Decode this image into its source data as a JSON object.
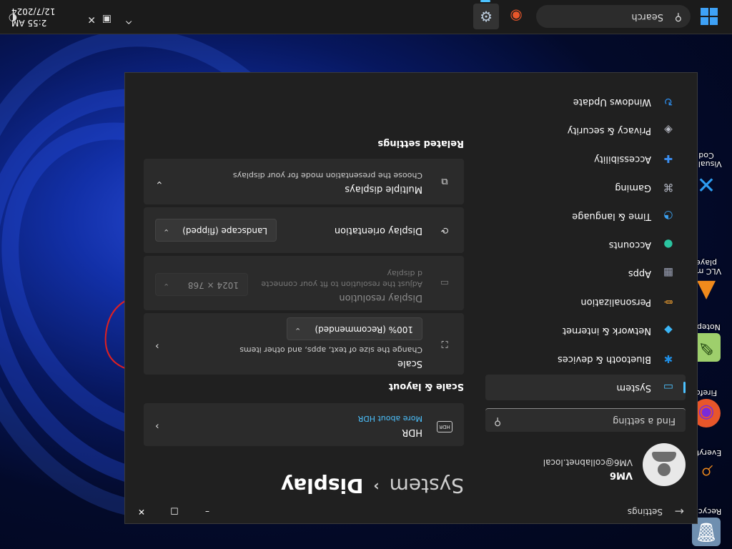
{
  "desktop": {
    "icons": [
      {
        "label": "Recycle",
        "glyph": "🗑"
      },
      {
        "label": "Everyth",
        "glyph": "⌕"
      },
      {
        "label": "Firefo",
        "glyph": "◉"
      },
      {
        "label": "Notepa",
        "glyph": "✎"
      },
      {
        "label": "VLC me\nplaye",
        "glyph": "▲"
      },
      {
        "label": "Visual S\nCod",
        "glyph": "✕"
      }
    ]
  },
  "window": {
    "app_title": "Settings",
    "back_icon": "back-arrow-icon",
    "controls": {
      "minimize": "–",
      "maximize": "□",
      "close": "✕"
    }
  },
  "nav": {
    "user_name": "VM6",
    "user_email": "VM6@collabnet.local",
    "search_placeholder": "Find a setting",
    "items": [
      {
        "label": "System",
        "icon": "system-icon",
        "glyph": "▭",
        "color": "#4cc2ff"
      },
      {
        "label": "Bluetooth & devices",
        "icon": "bluetooth-icon",
        "glyph": "✱",
        "color": "#1f8fe6"
      },
      {
        "label": "Network & internet",
        "icon": "network-icon",
        "glyph": "◆",
        "color": "#3bb5f5"
      },
      {
        "label": "Personalization",
        "icon": "personalization-icon",
        "glyph": "✏",
        "color": "#f0a030"
      },
      {
        "label": "Apps",
        "icon": "apps-icon",
        "glyph": "▦",
        "color": "#9aa0b4"
      },
      {
        "label": "Accounts",
        "icon": "accounts-icon",
        "glyph": "●",
        "color": "#2bc4a0"
      },
      {
        "label": "Time & language",
        "icon": "time-language-icon",
        "glyph": "◔",
        "color": "#3ba0f0"
      },
      {
        "label": "Gaming",
        "icon": "gaming-icon",
        "glyph": "⌘",
        "color": "#b0b4c0"
      },
      {
        "label": "Accessibility",
        "icon": "accessibility-icon",
        "glyph": "✚",
        "color": "#3b8ef0"
      },
      {
        "label": "Privacy & security",
        "icon": "privacy-icon",
        "glyph": "◈",
        "color": "#b9bcc6"
      },
      {
        "label": "Windows Update",
        "icon": "windows-update-icon",
        "glyph": "↻",
        "color": "#2e8ff0"
      }
    ]
  },
  "content": {
    "breadcrumb_parent": "System",
    "breadcrumb_current": "Display",
    "hdr": {
      "title": "HDR",
      "link": "More about HDR",
      "icon_text": "HDR"
    },
    "scale_layout_header": "Scale & layout",
    "scale": {
      "title": "Scale",
      "desc": "Change the size of text, apps, and other items",
      "value": "100% (Recommended)"
    },
    "resolution": {
      "title": "Display resolution",
      "desc_line1": "Adjust the resolution to fit your connecte",
      "desc_line2": "d display",
      "value": "1024 × 768"
    },
    "orientation": {
      "title": "Display orientation",
      "value": "Landscape (flipped)"
    },
    "multiple": {
      "title": "Multiple displays",
      "desc": "Choose the presentation mode for your displays"
    },
    "related_header": "Related settings"
  },
  "taskbar": {
    "search_placeholder": "Search",
    "time": "2:55 AM",
    "date": "12/7/2024"
  }
}
